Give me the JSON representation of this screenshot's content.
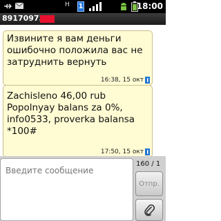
{
  "status_bar": {
    "time": "18:00",
    "network_label": "H",
    "sim_label": "1",
    "icons": [
      "usb-icon",
      "mail-icon",
      "network-type-icon",
      "sim-1-icon",
      "signal-icon",
      "android-icon",
      "battery-icon"
    ]
  },
  "header": {
    "contact_number": "891709737"
  },
  "messages": [
    {
      "text": "Извините я вам деньги ошибочно положила вас не затруднить вернуть",
      "timestamp": "16:38, 15 окт"
    },
    {
      "text": "Zachisleno 46,00 rub Popolnyay balans za 0%, info0533, proverka balansa *100#",
      "timestamp": "17:50, 15 окт"
    }
  ],
  "compose": {
    "placeholder": "Введите сообщение",
    "char_counter": "160 / 1",
    "send_label": "Отпр."
  },
  "colors": {
    "bubble_bg": "#fffbd3",
    "header_mask": "#e8102e",
    "sim_badge": "#1f74d8"
  }
}
